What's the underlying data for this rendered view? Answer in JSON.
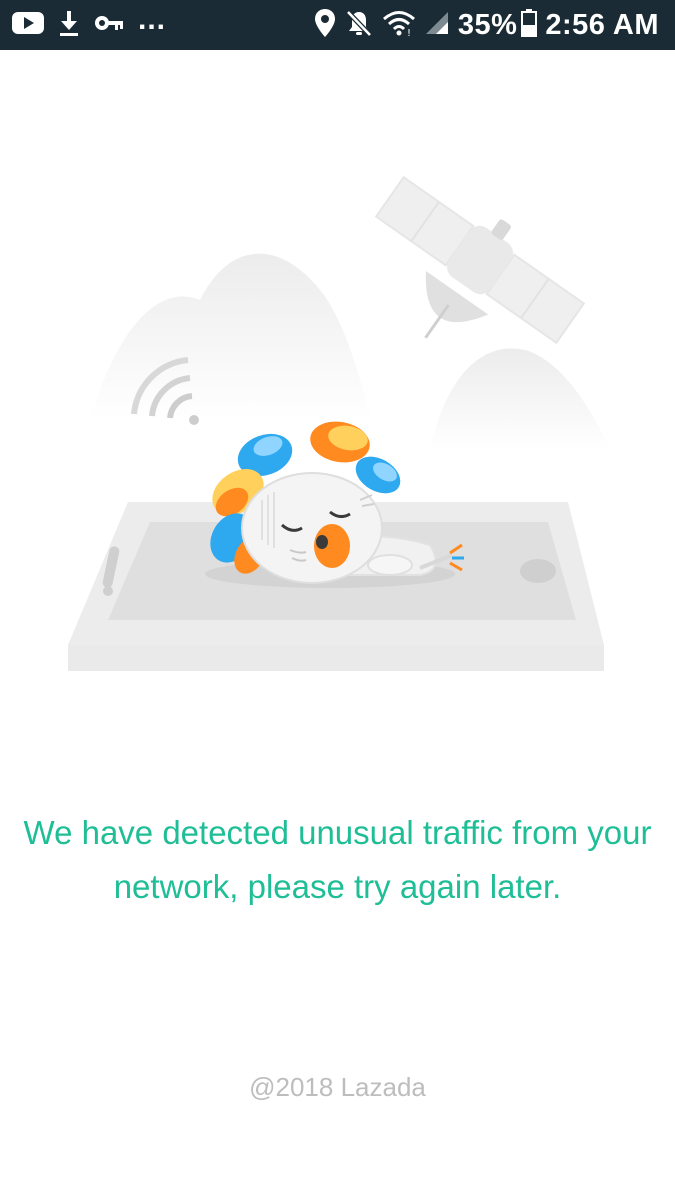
{
  "status_bar": {
    "icons_left": [
      "youtube-icon",
      "download-icon",
      "key-icon"
    ],
    "overflow": "...",
    "icons_right": [
      "location-icon",
      "mute-icon",
      "wifi-icon",
      "signal-icon"
    ],
    "battery_percent": "35%",
    "battery_icon": "battery-icon",
    "time": "2:56 AM"
  },
  "illustration": {
    "icons": [
      "satellite-icon",
      "wifi-signal-icon",
      "phone-icon",
      "sleeping-lion-mascot"
    ],
    "colors": {
      "blue": "#2ea8ee",
      "orange": "#ff8a1f",
      "yellow": "#ffd15c",
      "gray": "#e4e4e4"
    }
  },
  "message": {
    "text": "We have detected unusual traffic from your network, please try again later.",
    "color": "#1fbe96"
  },
  "footer": {
    "copyright": "@2018 Lazada"
  }
}
